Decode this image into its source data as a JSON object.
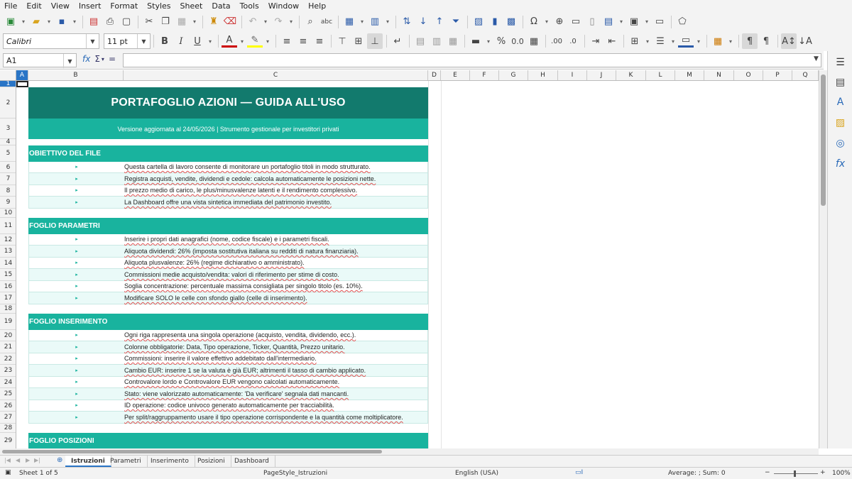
{
  "menu": [
    "File",
    "Edit",
    "View",
    "Insert",
    "Format",
    "Styles",
    "Sheet",
    "Data",
    "Tools",
    "Window",
    "Help"
  ],
  "font": {
    "name": "Calibri",
    "size": "11 pt"
  },
  "namebox": "A1",
  "columns": [
    "A",
    "B",
    "C",
    "D",
    "E",
    "F",
    "G",
    "H",
    "I",
    "J",
    "K",
    "L",
    "M",
    "N",
    "O",
    "P",
    "Q"
  ],
  "rows": [
    "1",
    "2",
    "3",
    "4",
    "5",
    "6",
    "7",
    "8",
    "9",
    "10",
    "11",
    "12",
    "13",
    "14",
    "15",
    "16",
    "17",
    "18",
    "19",
    "20",
    "21",
    "22",
    "23",
    "24",
    "25",
    "26",
    "27",
    "28",
    "29"
  ],
  "sheet": {
    "title": "PORTAFOGLIO AZIONI — GUIDA ALL'USO",
    "subtitle": "Versione aggiornata al 24/05/2026  |  Strumento gestionale per investitori privati",
    "bullet": "▸",
    "sections": [
      {
        "heading": "OBIETTIVO DEL FILE",
        "items": [
          "Questa cartella di lavoro consente di monitorare un portafoglio titoli in modo strutturato.",
          "Registra acquisti, vendite, dividendi e cedole: calcola automaticamente le posizioni nette.",
          "Il prezzo medio di carico, le plus/minusvalenze latenti e il rendimento complessivo.",
          "La Dashboard offre una vista sintetica immediata del patrimonio investito."
        ]
      },
      {
        "heading": "FOGLIO PARAMETRI",
        "items": [
          "Inserire i propri dati anagrafici (nome, codice fiscale) e i parametri fiscali.",
          "Aliquota dividendi: 26% (imposta sostitutiva italiana su redditi di natura finanziaria).",
          "Aliquota plusvalenze: 26% (regime dichiarativo o amministrato).",
          "Commissioni medie acquisto/vendita: valori di riferimento per stime di costo.",
          "Soglia concentrazione: percentuale massima consigliata per singolo titolo (es. 10%).",
          "Modificare SOLO le celle con sfondo giallo (celle di inserimento)."
        ]
      },
      {
        "heading": "FOGLIO INSERIMENTO",
        "items": [
          "Ogni riga rappresenta una singola operazione (acquisto, vendita, dividendo, ecc.).",
          "Colonne obbligatorie: Data, Tipo operazione, Ticker, Quantità, Prezzo unitario.",
          "Commissioni: inserire il valore effettivo addebitato dall'intermediario.",
          "Cambio EUR: inserire 1 se la valuta è già EUR; altrimenti il tasso di cambio applicato.",
          "Controvalore lordo e Controvalore EUR vengono calcolati automaticamente.",
          "Stato: viene valorizzato automaticamente: 'Da verificare' segnala dati mancanti.",
          "ID operazione: codice univoco generato automaticamente per tracciabilità.",
          "Per split/raggruppamento usare il tipo operazione corrispondente e la quantità come moltiplicatore."
        ]
      },
      {
        "heading": "FOGLIO POSIZIONI",
        "items": []
      }
    ]
  },
  "tabs": [
    "Istruzioni",
    "Parametri",
    "Inserimento",
    "Posizioni",
    "Dashboard"
  ],
  "status": {
    "sheet": "Sheet 1 of 5",
    "pagestyle": "PageStyle_Istruzioni",
    "language": "English (USA)",
    "summary": "Average: ; Sum: 0",
    "zoom": "100%"
  }
}
